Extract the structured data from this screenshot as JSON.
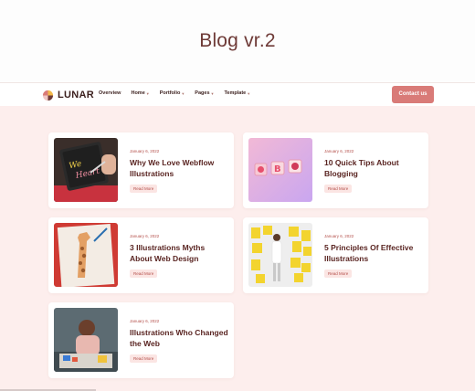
{
  "page": {
    "heading": "Blog vr.2"
  },
  "navbar": {
    "logo_text": "LUNAR",
    "links": [
      {
        "label": "Overview",
        "dropdown": false
      },
      {
        "label": "Home",
        "dropdown": true
      },
      {
        "label": "Portfolio",
        "dropdown": true
      },
      {
        "label": "Pages",
        "dropdown": true
      },
      {
        "label": "Template",
        "dropdown": true
      }
    ],
    "cta_label": "Contact us"
  },
  "posts": [
    {
      "date": "January 6, 2022",
      "title": "Why We Love Webflow Illustrations",
      "read_more": "Read More",
      "image": "tablet-lettering-illustration"
    },
    {
      "date": "January 6, 2022",
      "title": "10 Quick Tips About Blogging",
      "read_more": "Read More",
      "image": "3d-letter-blocks-illustration"
    },
    {
      "date": "January 6, 2022",
      "title": "3 Illustrations Myths About Web Design",
      "read_more": "Read More",
      "image": "giraffe-drawing-illustration"
    },
    {
      "date": "January 6, 2022",
      "title": "5 Principles Of Effective Illustrations",
      "read_more": "Read More",
      "image": "yellow-art-wall-illustration"
    },
    {
      "date": "January 6, 2022",
      "title": "Illustrations Who Changed the Web",
      "read_more": "Read More",
      "image": "artist-at-desk-illustration"
    }
  ],
  "colors": {
    "accent": "#d97b78",
    "section_background": "#fdeeed",
    "heading_text": "#6e3a37",
    "title_text": "#5a2522",
    "date_text": "#b4504b"
  }
}
